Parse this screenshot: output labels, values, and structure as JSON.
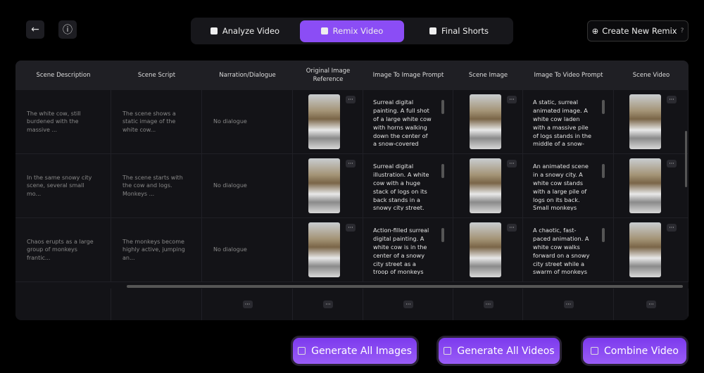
{
  "header": {
    "back_icon": "arrow-left-icon",
    "info_icon": "alert-circle-icon",
    "tabs": [
      {
        "label": "Analyze Video",
        "active": false
      },
      {
        "label": "Remix Video",
        "active": true
      },
      {
        "label": "Final Shorts",
        "active": false
      }
    ],
    "create_label": "Create New Remix"
  },
  "table": {
    "columns": [
      "Scene Description",
      "Scene Script",
      "Narration/Dialogue",
      "Original Image Reference",
      "Image To Image Prompt",
      "Scene Image",
      "Image To Video Prompt",
      "Scene Video"
    ],
    "rows": [
      {
        "description": "The white cow, still burdened with the massive ...",
        "script": "The scene shows a static image of the white cow...",
        "narration": "No dialogue",
        "i2i_prompt": "Surreal digital painting. A full shot of a large white cow with horns walking down the center of a snow-covered multi-lane city street.",
        "i2v_prompt": "A static, surreal animated image. A white cow laden with a massive pile of logs stands in the middle of a snow-covered city street. Ligh"
      },
      {
        "description": "In the same snowy city scene, several small mo...",
        "script": "The scene starts with the cow and logs. Monkeys ...",
        "narration": "No dialogue",
        "i2i_prompt": "Surreal digital illustration. A white cow with a huge stack of logs on its back stands in a snowy city street. Several small, mischievous m",
        "i2v_prompt": "An animated scene in a snowy city. A white cow stands with a large pile of logs on its back. Small monkeys materialize and quickly sw"
      },
      {
        "description": "Chaos erupts as a large group of monkeys frantic...",
        "script": "The monkeys become highly active, jumping an...",
        "narration": "No dialogue",
        "i2i_prompt": "Action-filled surreal digital painting. A white cow is in the center of a snowy city street as a troop of monkeys cause chaos. The large p",
        "i2v_prompt": "A chaotic, fast-paced animation. A white cow walks forward on a snowy city street while a swarm of monkeys frantically dismantle the"
      }
    ],
    "more_label": "···"
  },
  "actions": [
    {
      "label": "Generate All Images",
      "icon": "image-icon"
    },
    {
      "label": "Generate All Videos",
      "icon": "video-icon"
    },
    {
      "label": "Combine Video",
      "icon": "film-icon"
    }
  ],
  "accent": "#8b4df5"
}
